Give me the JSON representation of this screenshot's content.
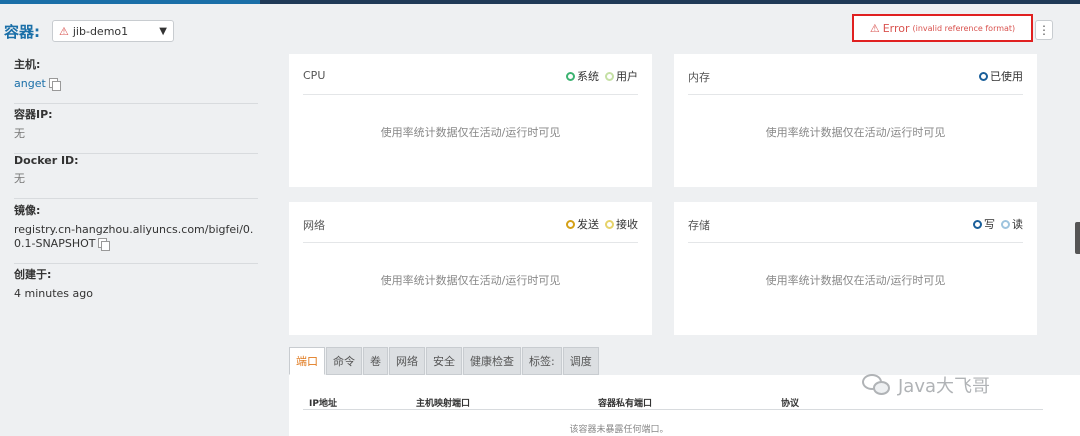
{
  "header": {
    "container_label": "容器:",
    "container_select": {
      "value": "jib-demo1"
    },
    "error_button": {
      "label": "Error",
      "detail": "(invalid reference format)"
    },
    "more_menu_icon": "vertical-ellipsis-icon"
  },
  "info": {
    "host": {
      "label": "主机:",
      "value": "anget"
    },
    "container_ip": {
      "label": "容器IP:",
      "value": "无"
    },
    "docker_id": {
      "label": "Docker ID:",
      "value": "无"
    },
    "image": {
      "label": "镜像:",
      "value": "registry.cn-hangzhou.aliyuncs.com/bigfei/0.0.1-SNAPSHOT"
    },
    "created": {
      "label": "创建于:",
      "value": "4 minutes ago"
    }
  },
  "cards": {
    "cpu": {
      "title": "CPU",
      "legend": [
        "系统",
        "用户"
      ],
      "message": "使用率统计数据仅在活动/运行时可见"
    },
    "memory": {
      "title": "内存",
      "legend": [
        "已使用"
      ],
      "message": "使用率统计数据仅在活动/运行时可见"
    },
    "network": {
      "title": "网络",
      "legend": [
        "发送",
        "接收"
      ],
      "message": "使用率统计数据仅在活动/运行时可见"
    },
    "storage": {
      "title": "存储",
      "legend": [
        "写",
        "读"
      ],
      "message": "使用率统计数据仅在活动/运行时可见"
    }
  },
  "tabs": [
    "端口",
    "命令",
    "卷",
    "网络",
    "安全",
    "健康检查",
    "标签:",
    "调度"
  ],
  "ports_table": {
    "columns": [
      "IP地址",
      "主机映射端口",
      "容器私有端口",
      "协议"
    ],
    "empty_message": "该容器未暴露任何端口。"
  },
  "watermark": {
    "text": "Java大飞哥"
  },
  "colors": {
    "accent": "#1a6fa8",
    "error": "#d9534f",
    "active_tab": "#e07a1f",
    "cpu_system": "#3cb371",
    "cpu_user": "#c5e0a5",
    "memory_used": "#1a5f9a",
    "net_send": "#d4a017",
    "net_recv": "#e6d36a",
    "storage_write": "#1a5f9a",
    "storage_read": "#9ec4de"
  }
}
